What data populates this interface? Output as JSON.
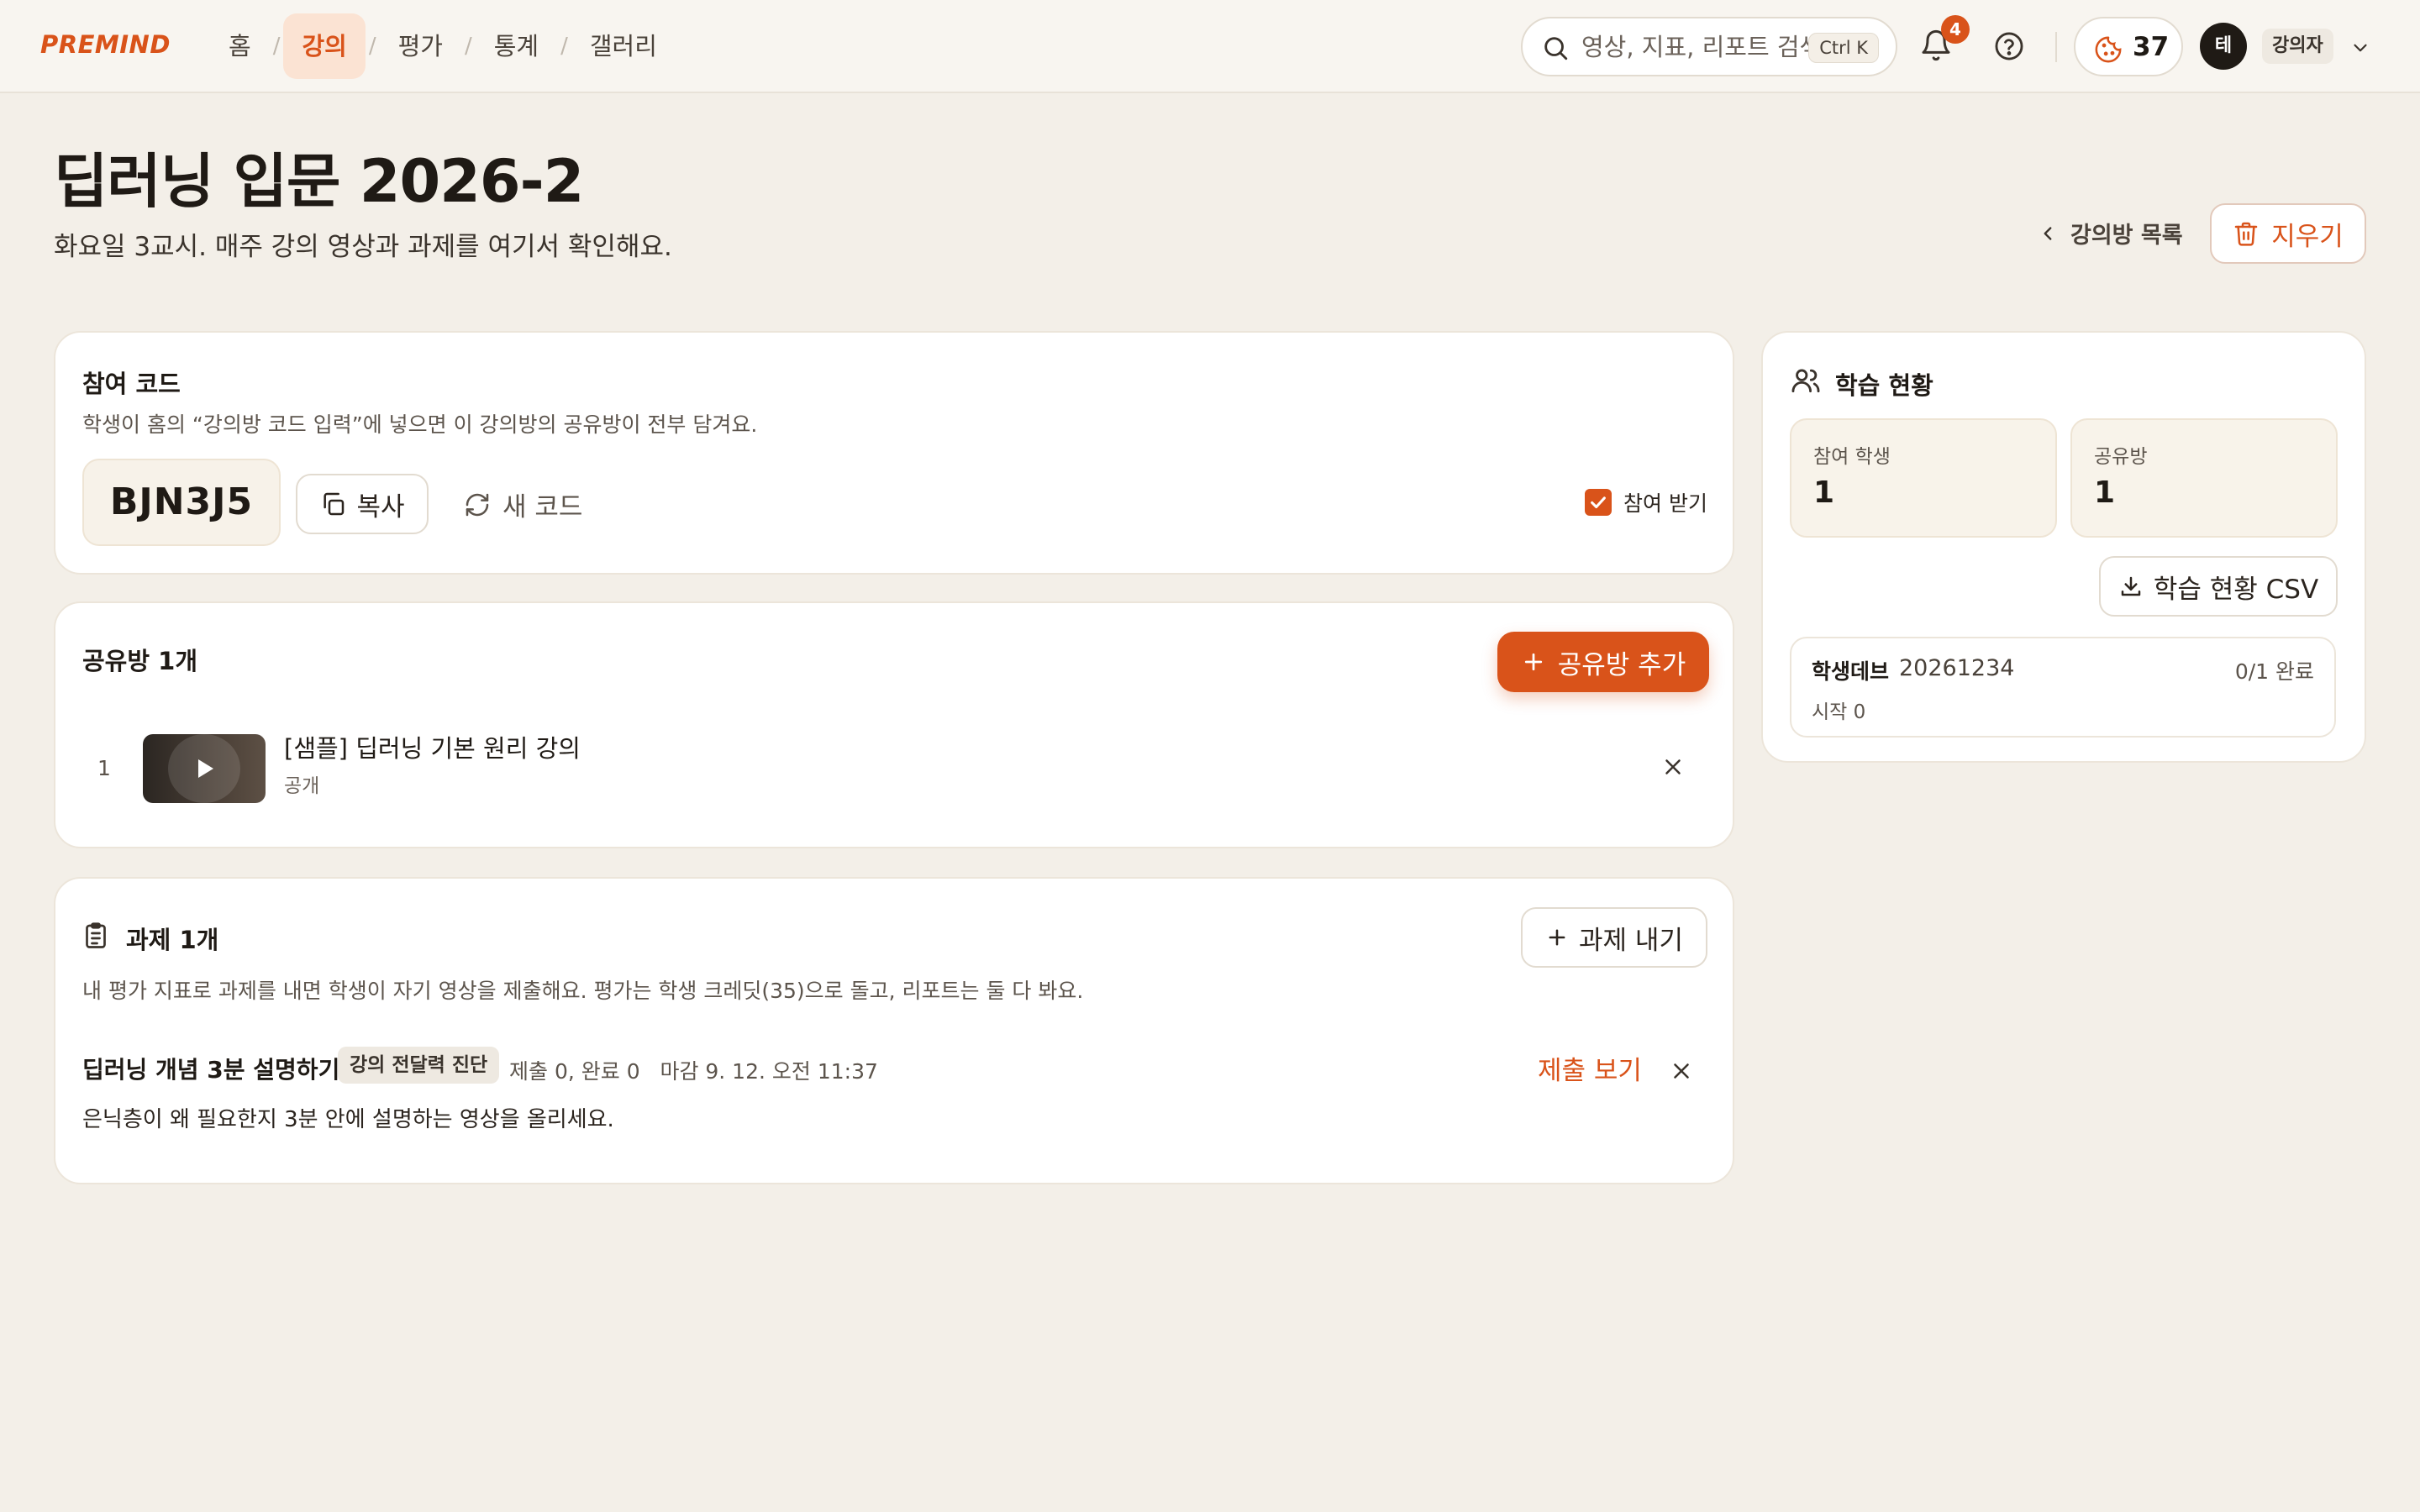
{
  "app": {
    "logo": "PREMIND"
  },
  "nav": {
    "items": [
      "홈",
      "강의",
      "평가",
      "통계",
      "갤러리"
    ],
    "separator": "/",
    "active": "강의"
  },
  "search": {
    "placeholder": "영상, 지표, 리포트 검색",
    "shortcut": "Ctrl K"
  },
  "notifications": {
    "count": "4"
  },
  "credits": {
    "value": "37"
  },
  "user": {
    "avatar_initial": "테",
    "role": "강의자"
  },
  "header": {
    "title": "딥러닝 입문 2026-2",
    "subtitle": "화요일 3교시. 매주 강의 영상과 과제를 여기서 확인해요.",
    "back_label": "강의방 목록",
    "delete_label": "지우기"
  },
  "join_code": {
    "title": "참여 코드",
    "desc": "학생이 홈의 “강의방 코드 입력”에 넣으면 이 강의방의 공유방이 전부 담겨요.",
    "code": "BJN3J5",
    "copy_label": "복사",
    "new_code_label": "새 코드",
    "accept_label": "참여 받기",
    "accept_checked": true
  },
  "rooms": {
    "title": "공유방 1개",
    "add_label": "공유방 추가",
    "items": [
      {
        "index": "1",
        "title": "[샘플] 딥러닝 기본 원리 강의",
        "visibility": "공개"
      }
    ]
  },
  "assignments": {
    "title": "과제 1개",
    "add_label": "과제 내기",
    "desc": "내 평가 지표로 과제를 내면 학생이 자기 영상을 제출해요. 평가는 학생 크레딧(35)으로 돌고, 리포트는 둘 다 봐요.",
    "items": [
      {
        "title": "딥러닝 개념 3분 설명하기",
        "tag": "강의 전달력 진단",
        "meta": "제출 0, 완료 0   마감 9. 12. 오전 11:37",
        "desc": "은닉층이 왜 필요한지 3분 안에 설명하는 영상을 올리세요.",
        "view_label": "제출 보기"
      }
    ]
  },
  "progress": {
    "title": "학습 현황",
    "stats": [
      {
        "label": "참여 학생",
        "value": "1"
      },
      {
        "label": "공유방",
        "value": "1"
      }
    ],
    "csv_label": "학습 현황 CSV",
    "students": [
      {
        "name": "학생데브",
        "id": "20261234",
        "done": "0/1 완료",
        "started": "시작 0"
      }
    ]
  },
  "colors": {
    "accent": "#d9531a",
    "background": "#f3efe8",
    "card": "#ffffff"
  }
}
